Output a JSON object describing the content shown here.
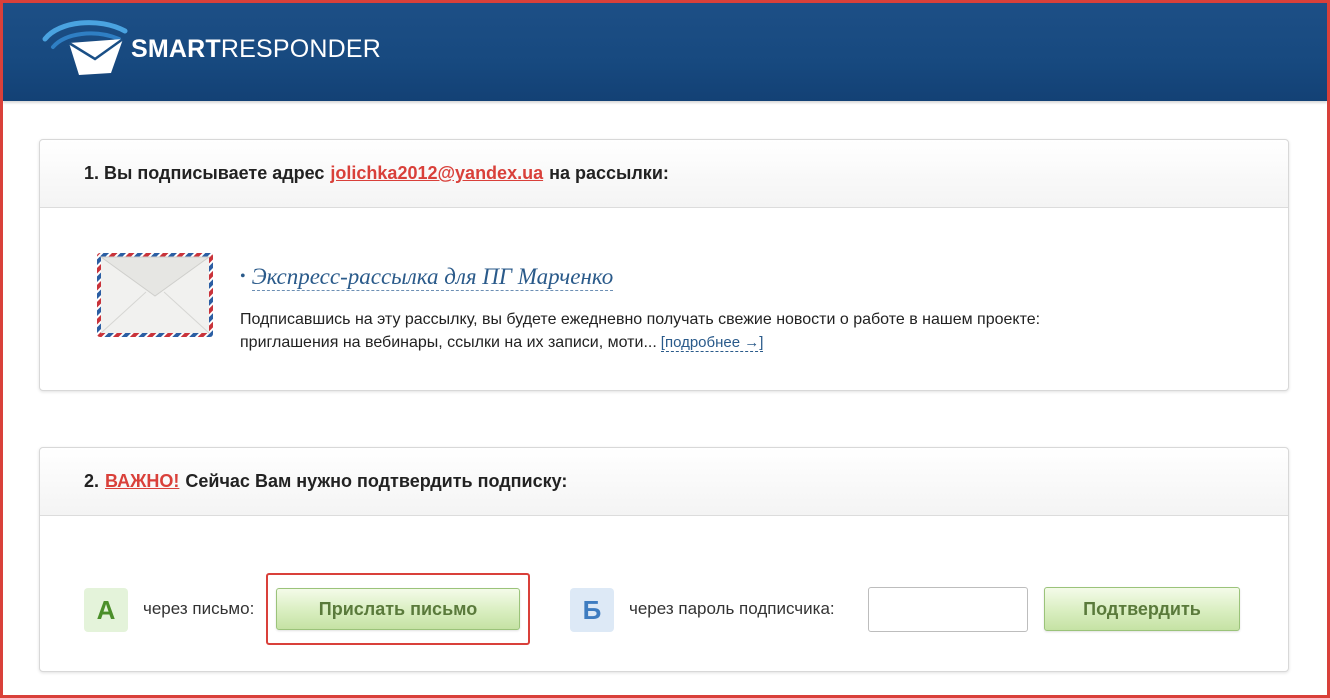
{
  "header": {
    "logo_bold": "SMART",
    "logo_rest": "RESPONDER",
    "logo_icon": "envelope-swoosh-logo"
  },
  "step1": {
    "prefix": "1. Вы подписываете адрес",
    "email": "jolichka2012@yandex.ua",
    "suffix": "на рассылки:",
    "list": {
      "title": "Экспресс-рассылка для ПГ Марченко",
      "desc_line1": "Подписавшись на эту рассылку, вы будете ежедневно получать свежие новости о работе в нашем проекте:",
      "desc_line2": "приглашения на вебинары, ссылки на их записи, моти...",
      "more": "[подробнее →]",
      "icon": "envelope-icon"
    }
  },
  "step2": {
    "prefix": "2.",
    "important": "ВАЖНО!",
    "suffix": "Сейчас Вам нужно подтвердить подписку:",
    "option_a": {
      "badge": "А",
      "label": "через письмо:",
      "button": "Прислать письмо"
    },
    "option_b": {
      "badge": "Б",
      "label": "через пароль подписчика:",
      "input_value": "",
      "button": "Подтвердить"
    }
  },
  "colors": {
    "accent_red": "#d9403a",
    "header_blue": "#17497f",
    "link_blue": "#2a5a8a",
    "button_green": "#d9eec0"
  }
}
